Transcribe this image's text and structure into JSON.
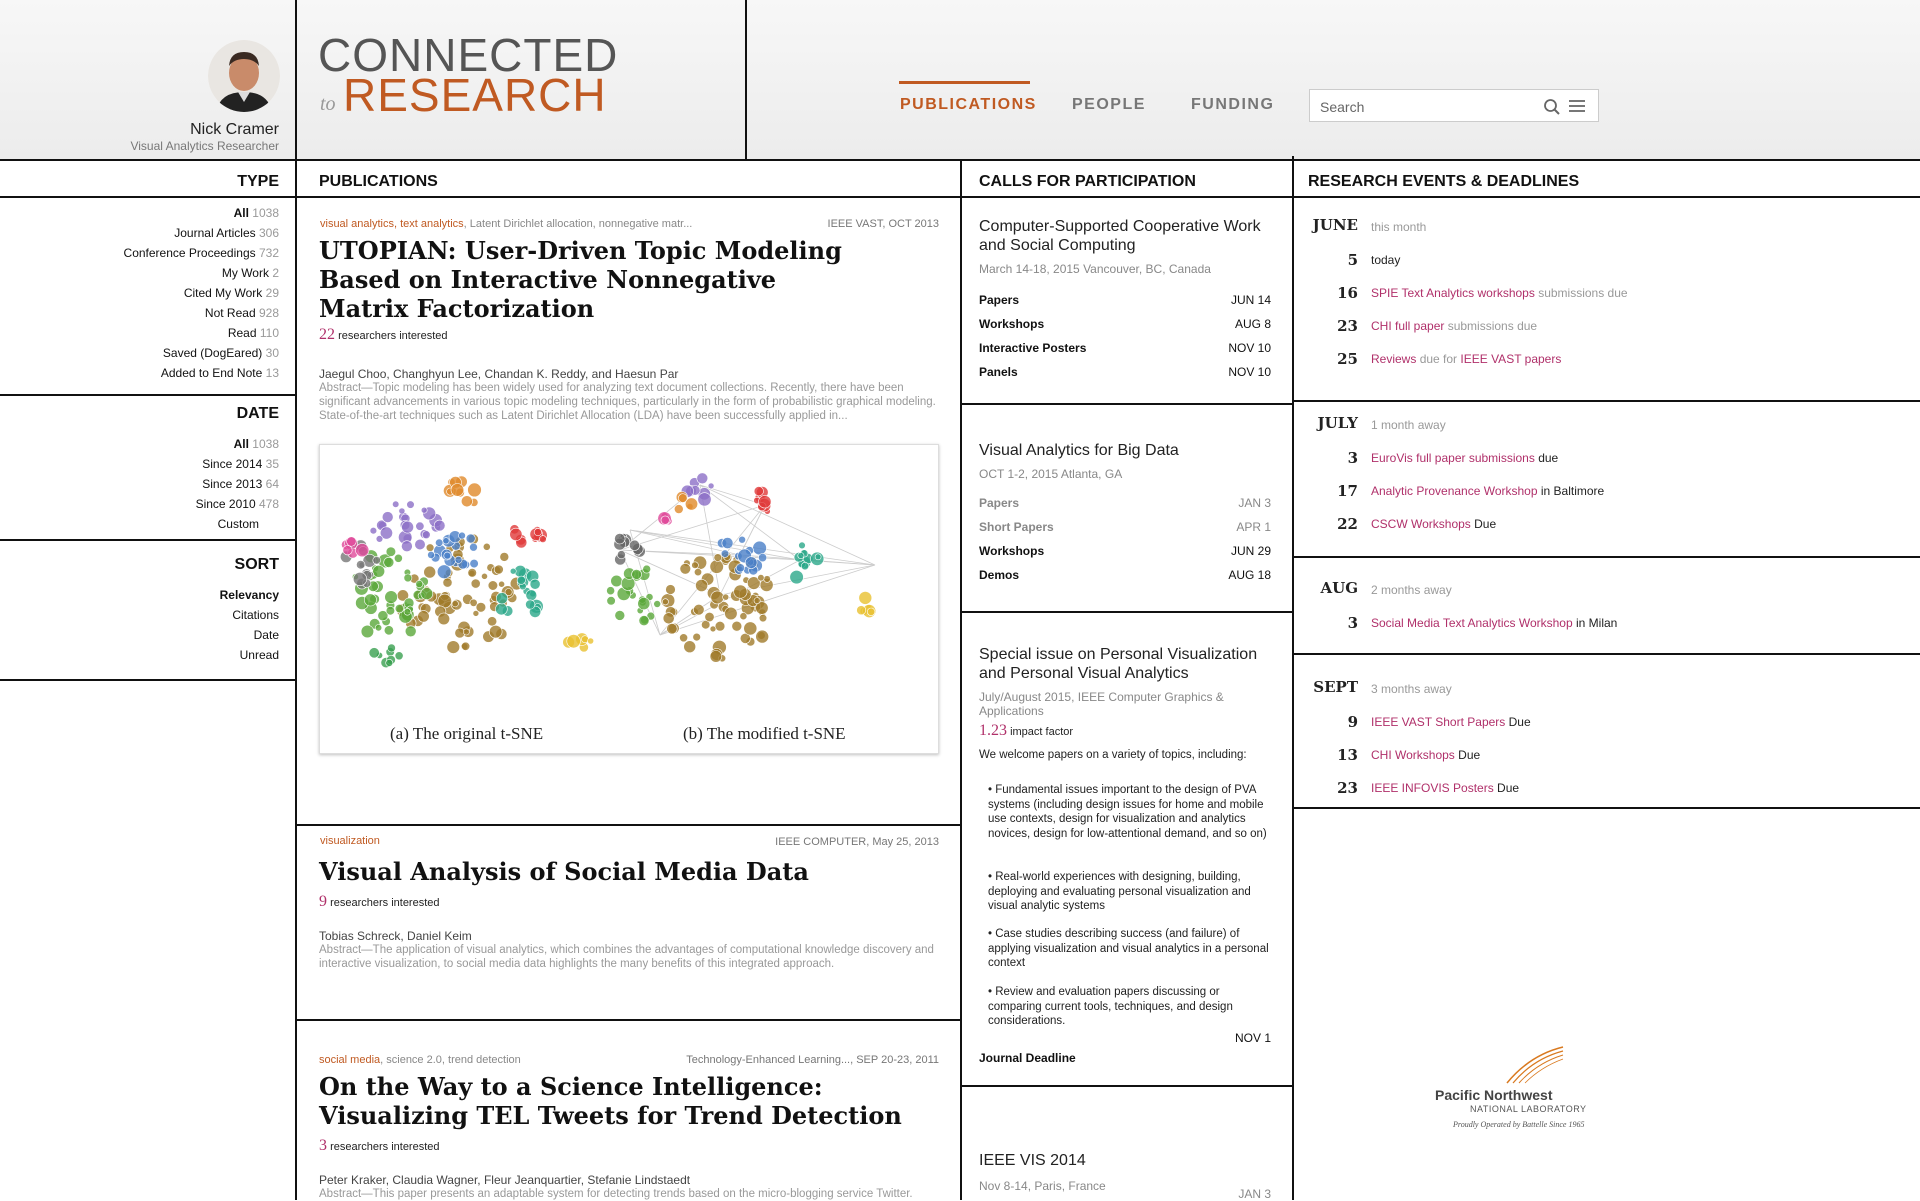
{
  "user": {
    "name": "Nick Cramer",
    "role": "Visual Analytics Researcher"
  },
  "logo": {
    "line1": "CONNECTED",
    "to": "to",
    "line2": "RESEARCH"
  },
  "nav": {
    "items": [
      {
        "label": "PUBLICATIONS"
      },
      {
        "label": "PEOPLE"
      },
      {
        "label": "FUNDING"
      }
    ]
  },
  "search": {
    "placeholder": "Search"
  },
  "filters": {
    "type": {
      "heading": "TYPE",
      "items": [
        {
          "label": "All",
          "count": "1038"
        },
        {
          "label": "Journal Articles",
          "count": "306"
        },
        {
          "label": "Conference Proceedings",
          "count": "732"
        },
        {
          "label": "My Work",
          "count": "2"
        },
        {
          "label": "Cited My Work",
          "count": "29"
        },
        {
          "label": "Not Read",
          "count": "928"
        },
        {
          "label": "Read",
          "count": "110"
        },
        {
          "label": "Saved (DogEared)",
          "count": "30"
        },
        {
          "label": "Added to End Note",
          "count": "13"
        }
      ]
    },
    "date": {
      "heading": "DATE",
      "items": [
        {
          "label": "All",
          "count": "1038"
        },
        {
          "label": "Since 2014",
          "count": "35"
        },
        {
          "label": "Since 2013",
          "count": "64"
        },
        {
          "label": "Since 2010",
          "count": "478"
        },
        {
          "label": "Custom",
          "count": ""
        }
      ]
    },
    "sort": {
      "heading": "SORT",
      "items": [
        {
          "label": "Relevancy"
        },
        {
          "label": "Citations"
        },
        {
          "label": "Date"
        },
        {
          "label": "Unread"
        }
      ]
    }
  },
  "publications": {
    "heading": "PUBLICATIONS",
    "items": [
      {
        "tags_orange": "visual analytics, text analytics",
        "tags_gray": ", Latent Dirichlet allocation, nonnegative matr...",
        "venue": "IEEE VAST, OCT 2013",
        "title": "UTOPIAN: User-Driven Topic Modeling Based on Interactive Nonnegative Matrix Factorization",
        "interest_count": "22",
        "interest_label": "researchers interested",
        "authors": "Jaegul Choo, Changhyun Lee, Chandan K. Reddy, and Haesun Par",
        "abstract": "Abstract—Topic modeling has been widely used for analyzing text document collections. Recently, there have been significant advancements in various topic modeling techniques, particularly in the form of probabilistic graphical modeling. State-of-the-art techniques such as Latent Dirichlet Allocation (LDA) have been successfully applied in...",
        "figure_captions": [
          "(a) The original t-SNE",
          "(b) The modified t-SNE"
        ]
      },
      {
        "tags_orange": "visualization",
        "tags_gray": "",
        "venue": "IEEE COMPUTER, May 25, 2013",
        "title": "Visual Analysis of Social Media Data",
        "interest_count": "9",
        "interest_label": "researchers interested",
        "authors": "Tobias Schreck, Daniel Keim",
        "abstract": "Abstract—The application of visual analytics, which combines the advantages of computational knowledge discovery and interactive visualization, to social media data highlights the many benefits of this integrated approach."
      },
      {
        "tags_orange": "social media",
        "tags_gray": ", science 2.0, trend detection",
        "venue": "Technology-Enhanced Learning..., SEP 20-23, 2011",
        "title": "On the Way to a Science Intelligence: Visualizing TEL Tweets for Trend Detection",
        "interest_count": "3",
        "interest_label": "researchers interested",
        "authors": "Peter Kraker, Claudia Wagner, Fleur Jeanquartier, Stefanie Lindstaedt",
        "abstract": "Abstract—This paper presents an adaptable system for detecting trends based on the micro-blogging service Twitter."
      }
    ]
  },
  "calls": {
    "heading": "CALLS FOR PARTICIPATION",
    "items": [
      {
        "title": "Computer-Supported Cooperative Work and Social Computing",
        "sub": "March 14-18, 2015 Vancouver, BC, Canada",
        "rows": [
          {
            "label": "Papers",
            "date": "JUN 14"
          },
          {
            "label": "Workshops",
            "date": "AUG 8"
          },
          {
            "label": "Interactive Posters",
            "date": "NOV 10"
          },
          {
            "label": "Panels",
            "date": "NOV 10"
          }
        ]
      },
      {
        "title": "Visual Analytics for Big Data",
        "sub": "OCT 1-2, 2015 Atlanta, GA",
        "rows": [
          {
            "label": "Papers",
            "date": "JAN 3"
          },
          {
            "label": "Short Papers",
            "date": "APR 1"
          },
          {
            "label": "Workshops",
            "date": "JUN 29"
          },
          {
            "label": "Demos",
            "date": "AUG 18"
          }
        ]
      },
      {
        "title": "Special issue on Personal Visualization and Personal Visual Analytics",
        "sub": "July/August 2015, IEEE Computer Graphics & Applications",
        "impact_value": "1.23",
        "impact_label": "impact factor",
        "intro": "We welcome papers on a variety of topics, including:",
        "bullets": [
          "• Fundamental issues important to the design of PVA systems (including design issues for home and mobile use contexts, design for visualization and analytics novices, design for low-attentional demand, and so on)",
          "• Real-world experiences with designing, building, deploying and evaluating personal visualization and visual analytic systems",
          "• Case studies describing success (and failure) of applying visualization and visual analytics in a personal context",
          "• Review and evaluation papers discussing or comparing current tools, techniques, and design considerations."
        ],
        "deadline_date": "NOV 1",
        "deadline_label": "Journal Deadline"
      },
      {
        "title": "IEEE VIS 2014",
        "sub": "Nov 8-14, Paris, France",
        "rows": [
          {
            "label": "",
            "date": "JAN 3"
          }
        ]
      }
    ]
  },
  "events": {
    "heading": "RESEARCH EVENTS & DEADLINES",
    "months": [
      {
        "month": "JUNE",
        "note": "this month",
        "items": [
          {
            "day": "5",
            "link": "",
            "text": "today",
            "muted": ""
          },
          {
            "day": "16",
            "link": "SPIE Text Analytics workshops",
            "text": "",
            "muted": " submissions due"
          },
          {
            "day": "23",
            "link": "CHI full paper",
            "text": "",
            "muted": " submissions due"
          },
          {
            "day": "25",
            "link": "Reviews",
            "text": "",
            "muted": " due for ",
            "link2": "IEEE VAST papers"
          }
        ]
      },
      {
        "month": "JULY",
        "note": "1 month away",
        "items": [
          {
            "day": "3",
            "link": "EuroVis full paper submissions",
            "text": " due"
          },
          {
            "day": "17",
            "link": "Analytic Provenance Workshop",
            "text": " in Baltimore"
          },
          {
            "day": "22",
            "link": "CSCW Workshops",
            "text": " Due"
          }
        ]
      },
      {
        "month": "AUG",
        "note": "2 months away",
        "items": [
          {
            "day": "3",
            "link": "Social Media Text Analytics Workshop",
            "text": " in Milan"
          }
        ]
      },
      {
        "month": "SEPT",
        "note": "3 months away",
        "items": [
          {
            "day": "9",
            "link": "IEEE VAST Short Papers",
            "text": " Due"
          },
          {
            "day": "13",
            "link": "CHI Workshops",
            "text": " Due"
          },
          {
            "day": "23",
            "link": "IEEE INFOVIS Posters",
            "text": " Due"
          }
        ]
      }
    ]
  },
  "sponsor": {
    "name": "Pacific Northwest",
    "sub": "NATIONAL LABORATORY",
    "tagline": "Proudly Operated by Battelle Since 1965"
  },
  "colors": {
    "accent": "#c05a22",
    "link": "#b0306a",
    "rule": "#111111"
  }
}
